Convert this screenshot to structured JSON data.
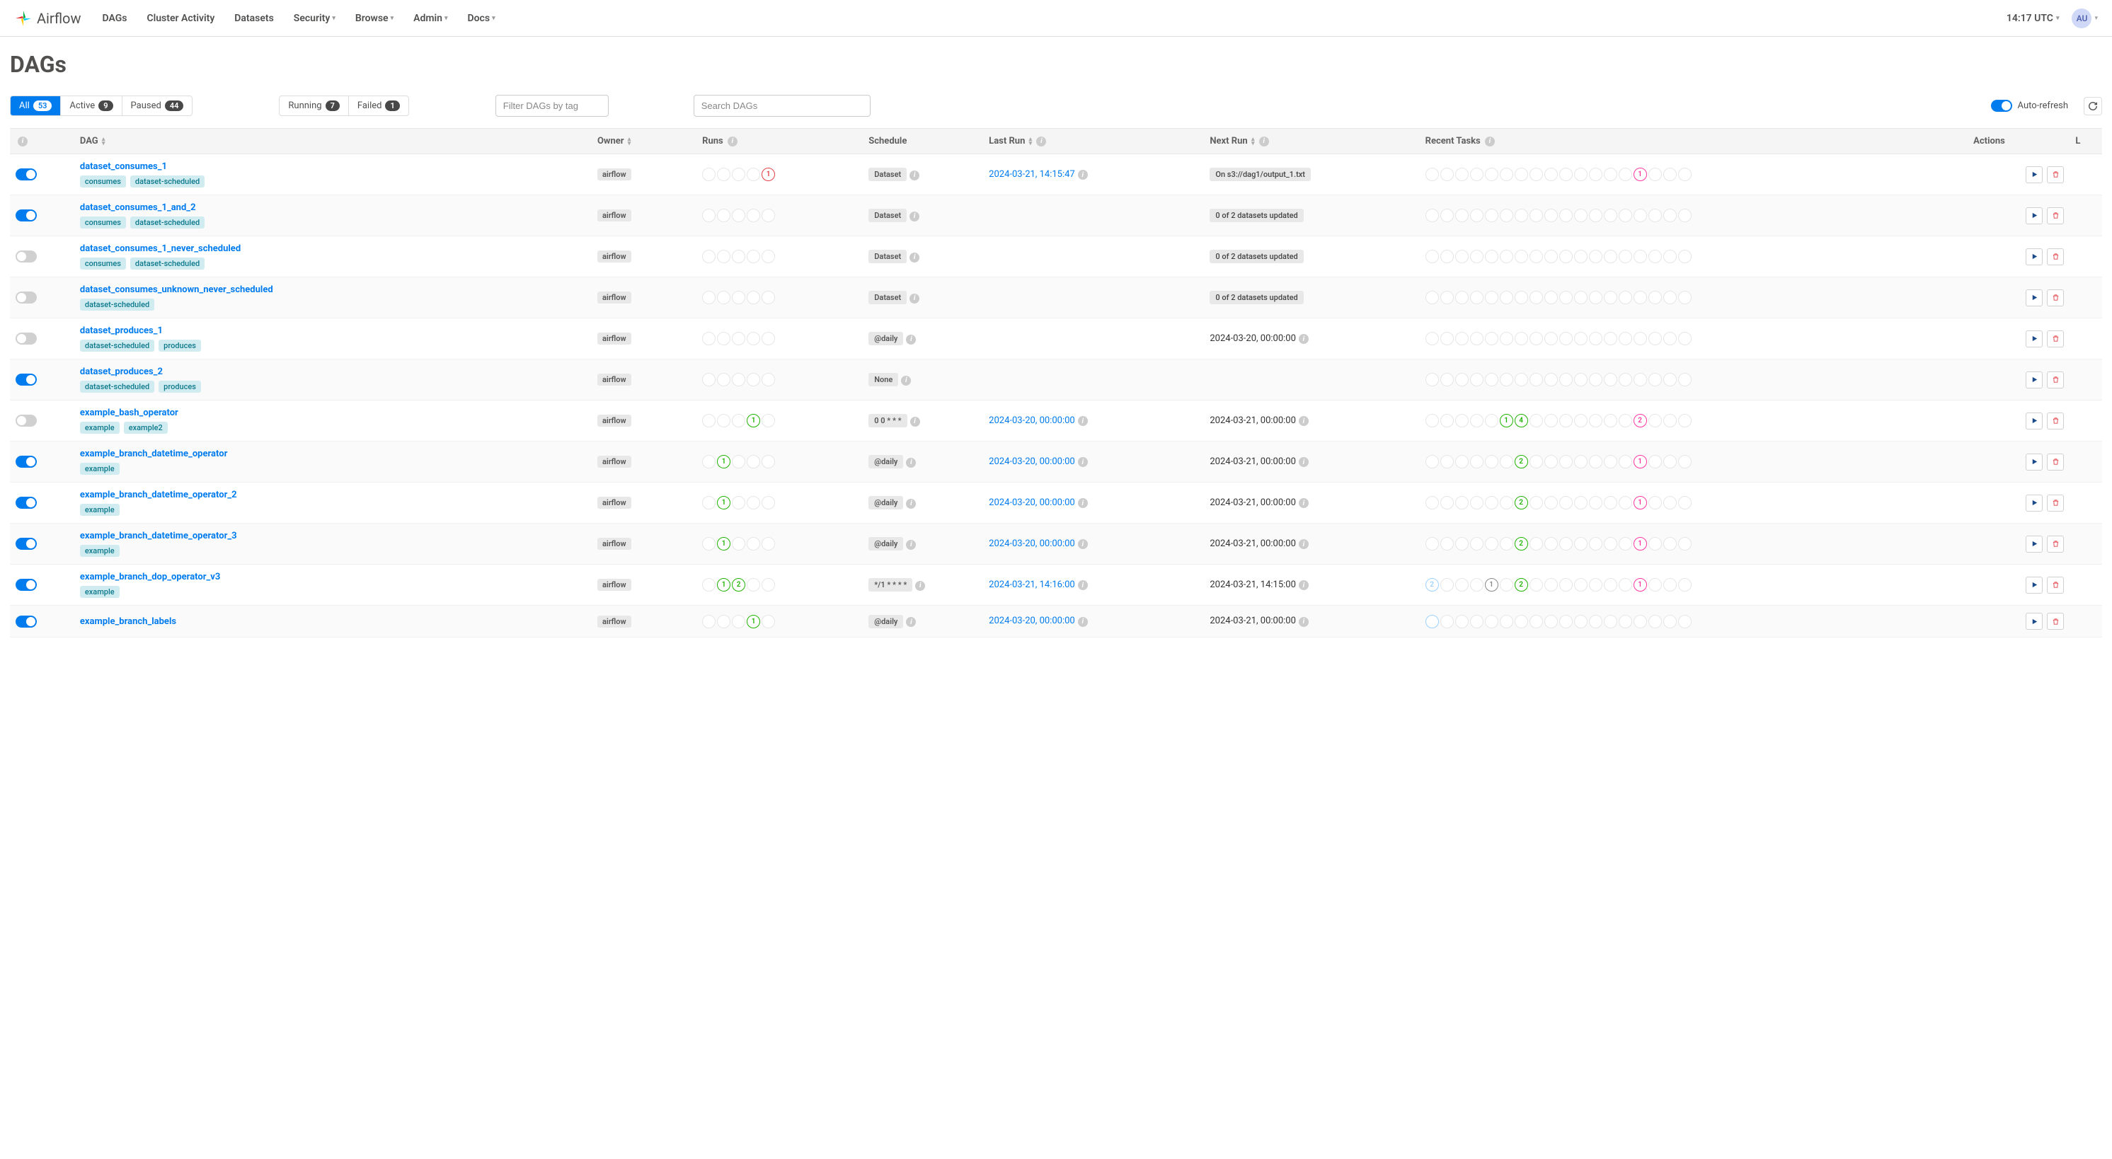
{
  "brand": "Airflow",
  "nav": {
    "dags": "DAGs",
    "cluster": "Cluster Activity",
    "datasets": "Datasets",
    "security": "Security",
    "browse": "Browse",
    "admin": "Admin",
    "docs": "Docs"
  },
  "clock": "14:17 UTC",
  "avatar": "AU",
  "page_title": "DAGs",
  "filters": {
    "all_label": "All",
    "all_count": "53",
    "active_label": "Active",
    "active_count": "9",
    "paused_label": "Paused",
    "paused_count": "44",
    "running_label": "Running",
    "running_count": "7",
    "failed_label": "Failed",
    "failed_count": "1",
    "tag_placeholder": "Filter DAGs by tag",
    "search_placeholder": "Search DAGs",
    "auto_refresh": "Auto-refresh"
  },
  "headers": {
    "dag": "DAG",
    "owner": "Owner",
    "runs": "Runs",
    "schedule": "Schedule",
    "last_run": "Last Run",
    "next_run": "Next Run",
    "recent_tasks": "Recent Tasks",
    "actions": "Actions",
    "links": "L"
  },
  "colors": {
    "success": "#1eb300",
    "failed": "#e23f44",
    "running": "#1eb300",
    "skipped": "#ff7fb6",
    "queued": "#808080",
    "upstream": "#888",
    "light": "#9cd2ff"
  },
  "rows": [
    {
      "on": true,
      "name": "dataset_consumes_1",
      "tags": [
        "consumes",
        "dataset-scheduled"
      ],
      "owner": "airflow",
      "runs": [
        null,
        null,
        null,
        null,
        {
          "n": "1",
          "c": "#e23f44"
        }
      ],
      "schedule": "Dataset",
      "last_run": "2024-03-21, 14:15:47",
      "next_pill": "On s3://dag1/output_1.txt",
      "tasks": [
        null,
        null,
        null,
        null,
        null,
        null,
        null,
        null,
        null,
        null,
        null,
        null,
        null,
        null,
        {
          "n": "1",
          "c": "#ff36a3"
        },
        null,
        null,
        null
      ]
    },
    {
      "on": true,
      "name": "dataset_consumes_1_and_2",
      "tags": [
        "consumes",
        "dataset-scheduled"
      ],
      "owner": "airflow",
      "runs": [
        null,
        null,
        null,
        null,
        null
      ],
      "schedule": "Dataset",
      "last_run": "",
      "next_pill": "0 of 2 datasets updated",
      "tasks": [
        null,
        null,
        null,
        null,
        null,
        null,
        null,
        null,
        null,
        null,
        null,
        null,
        null,
        null,
        null,
        null,
        null,
        null
      ]
    },
    {
      "on": false,
      "name": "dataset_consumes_1_never_scheduled",
      "tags": [
        "consumes",
        "dataset-scheduled"
      ],
      "owner": "airflow",
      "runs": [
        null,
        null,
        null,
        null,
        null
      ],
      "schedule": "Dataset",
      "last_run": "",
      "next_pill": "0 of 2 datasets updated",
      "tasks": [
        null,
        null,
        null,
        null,
        null,
        null,
        null,
        null,
        null,
        null,
        null,
        null,
        null,
        null,
        null,
        null,
        null,
        null
      ]
    },
    {
      "on": false,
      "name": "dataset_consumes_unknown_never_scheduled",
      "tags": [
        "dataset-scheduled"
      ],
      "owner": "airflow",
      "runs": [
        null,
        null,
        null,
        null,
        null
      ],
      "schedule": "Dataset",
      "last_run": "",
      "next_pill": "0 of 2 datasets updated",
      "tasks": [
        null,
        null,
        null,
        null,
        null,
        null,
        null,
        null,
        null,
        null,
        null,
        null,
        null,
        null,
        null,
        null,
        null,
        null
      ]
    },
    {
      "on": false,
      "name": "dataset_produces_1",
      "tags": [
        "dataset-scheduled",
        "produces"
      ],
      "owner": "airflow",
      "runs": [
        null,
        null,
        null,
        null,
        null
      ],
      "schedule": "@daily",
      "last_run": "",
      "next_text": "2024-03-20, 00:00:00",
      "tasks": [
        null,
        null,
        null,
        null,
        null,
        null,
        null,
        null,
        null,
        null,
        null,
        null,
        null,
        null,
        null,
        null,
        null,
        null
      ]
    },
    {
      "on": true,
      "name": "dataset_produces_2",
      "tags": [
        "dataset-scheduled",
        "produces"
      ],
      "owner": "airflow",
      "runs": [
        null,
        null,
        null,
        null,
        null
      ],
      "schedule": "None",
      "last_run": "",
      "next_text": "",
      "tasks": [
        null,
        null,
        null,
        null,
        null,
        null,
        null,
        null,
        null,
        null,
        null,
        null,
        null,
        null,
        null,
        null,
        null,
        null
      ]
    },
    {
      "on": false,
      "name": "example_bash_operator",
      "tags": [
        "example",
        "example2"
      ],
      "owner": "airflow",
      "runs": [
        null,
        null,
        null,
        {
          "n": "1",
          "c": "#1eb300"
        },
        null
      ],
      "schedule": "0 0 * * *",
      "last_run": "2024-03-20, 00:00:00",
      "next_text": "2024-03-21, 00:00:00",
      "tasks": [
        null,
        null,
        null,
        null,
        null,
        {
          "n": "1",
          "c": "#1eb300"
        },
        {
          "n": "4",
          "c": "#1eb300"
        },
        null,
        null,
        null,
        null,
        null,
        null,
        null,
        {
          "n": "2",
          "c": "#ff36a3"
        },
        null,
        null,
        null
      ]
    },
    {
      "on": true,
      "name": "example_branch_datetime_operator",
      "tags": [
        "example"
      ],
      "owner": "airflow",
      "runs": [
        null,
        {
          "n": "1",
          "c": "#1eb300"
        },
        null,
        null,
        null
      ],
      "schedule": "@daily",
      "last_run": "2024-03-20, 00:00:00",
      "next_text": "2024-03-21, 00:00:00",
      "tasks": [
        null,
        null,
        null,
        null,
        null,
        null,
        {
          "n": "2",
          "c": "#1eb300"
        },
        null,
        null,
        null,
        null,
        null,
        null,
        null,
        {
          "n": "1",
          "c": "#ff36a3"
        },
        null,
        null,
        null
      ]
    },
    {
      "on": true,
      "name": "example_branch_datetime_operator_2",
      "tags": [
        "example"
      ],
      "owner": "airflow",
      "runs": [
        null,
        {
          "n": "1",
          "c": "#1eb300"
        },
        null,
        null,
        null
      ],
      "schedule": "@daily",
      "last_run": "2024-03-20, 00:00:00",
      "next_text": "2024-03-21, 00:00:00",
      "tasks": [
        null,
        null,
        null,
        null,
        null,
        null,
        {
          "n": "2",
          "c": "#1eb300"
        },
        null,
        null,
        null,
        null,
        null,
        null,
        null,
        {
          "n": "1",
          "c": "#ff36a3"
        },
        null,
        null,
        null
      ]
    },
    {
      "on": true,
      "name": "example_branch_datetime_operator_3",
      "tags": [
        "example"
      ],
      "owner": "airflow",
      "runs": [
        null,
        {
          "n": "1",
          "c": "#1eb300"
        },
        null,
        null,
        null
      ],
      "schedule": "@daily",
      "last_run": "2024-03-20, 00:00:00",
      "next_text": "2024-03-21, 00:00:00",
      "tasks": [
        null,
        null,
        null,
        null,
        null,
        null,
        {
          "n": "2",
          "c": "#1eb300"
        },
        null,
        null,
        null,
        null,
        null,
        null,
        null,
        {
          "n": "1",
          "c": "#ff36a3"
        },
        null,
        null,
        null
      ]
    },
    {
      "on": true,
      "name": "example_branch_dop_operator_v3",
      "tags": [
        "example"
      ],
      "owner": "airflow",
      "runs": [
        null,
        {
          "n": "1",
          "c": "#1eb300"
        },
        {
          "n": "2",
          "c": "#1eb300"
        },
        null,
        null
      ],
      "schedule": "*/1 * * * *",
      "last_run": "2024-03-21, 14:16:00",
      "next_text": "2024-03-21, 14:15:00",
      "tasks": [
        {
          "n": "2",
          "c": "#9cd2ff"
        },
        null,
        null,
        null,
        {
          "n": "1",
          "c": "#888"
        },
        null,
        {
          "n": "2",
          "c": "#1eb300"
        },
        null,
        null,
        null,
        null,
        null,
        null,
        null,
        {
          "n": "1",
          "c": "#ff36a3"
        },
        null,
        null,
        null
      ]
    },
    {
      "on": true,
      "name": "example_branch_labels",
      "tags": [],
      "owner": "airflow",
      "runs": [
        null,
        null,
        null,
        {
          "n": "1",
          "c": "#1eb300"
        },
        null
      ],
      "schedule": "@daily",
      "last_run": "2024-03-20, 00:00:00",
      "next_text": "2024-03-21, 00:00:00",
      "tasks": [
        {
          "n": "",
          "c": "#9cd2ff"
        },
        null,
        null,
        null,
        null,
        null,
        null,
        null,
        null,
        null,
        null,
        null,
        null,
        null,
        null,
        null,
        null,
        null
      ]
    }
  ]
}
